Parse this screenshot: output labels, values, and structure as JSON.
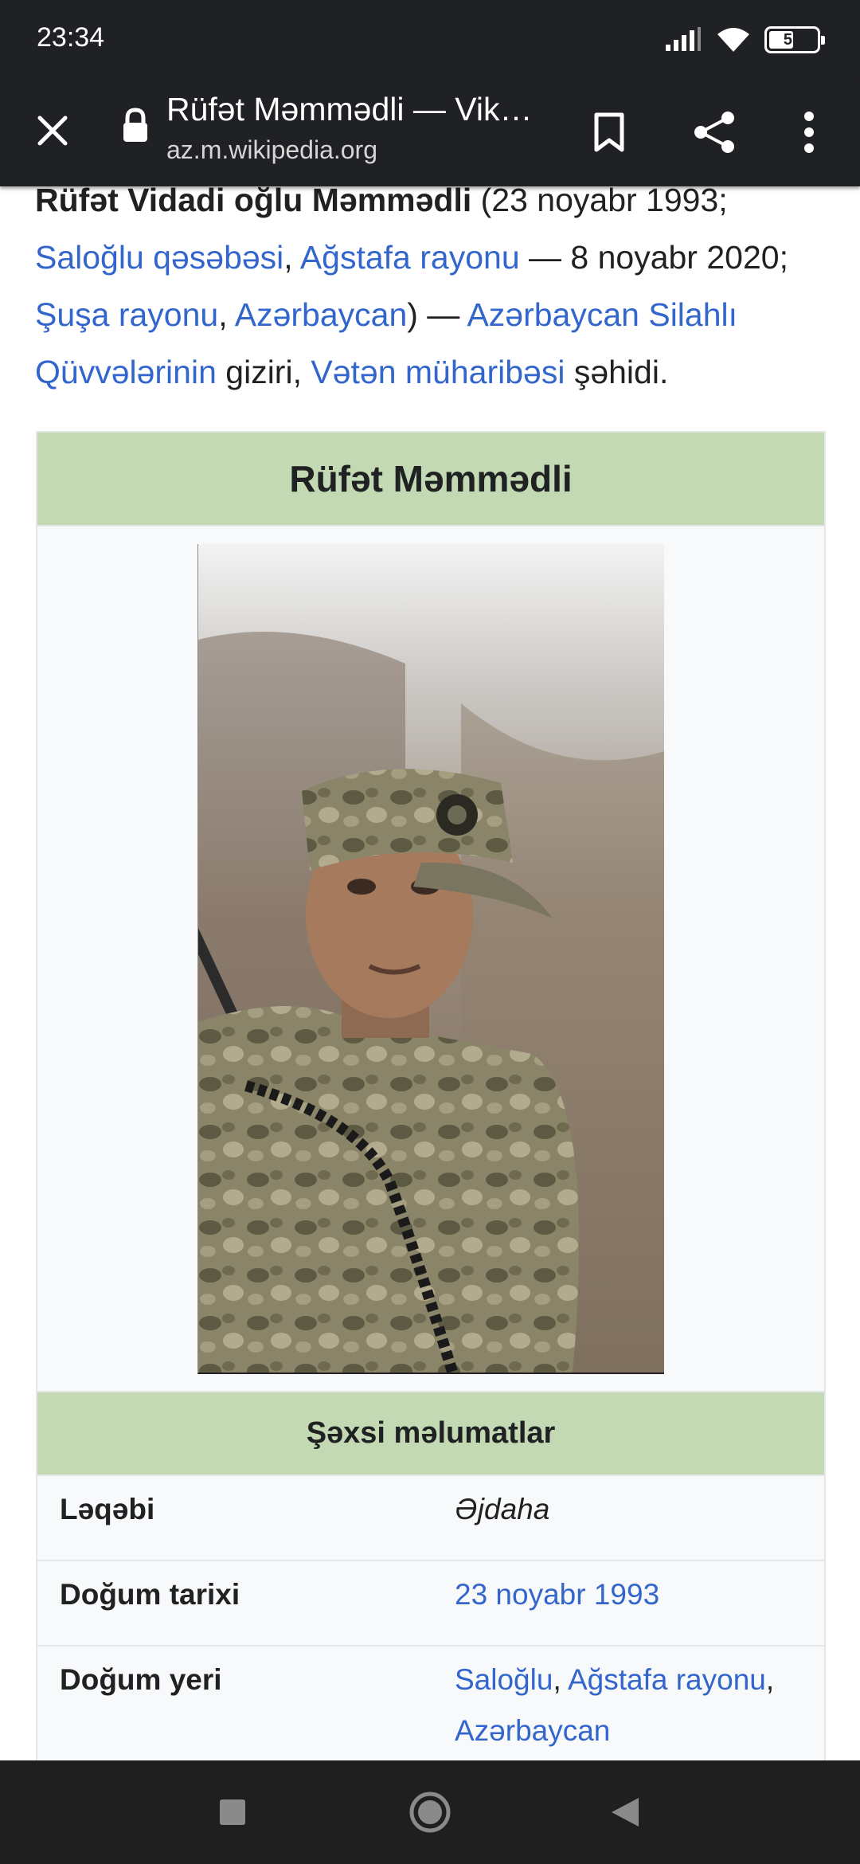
{
  "status_bar": {
    "time": "23:34",
    "battery": "55"
  },
  "browser": {
    "page_title": "Rüfət Məmmədli — Vik…",
    "url": "az.m.wikipedia.org",
    "icons": [
      "close-icon",
      "lock-icon",
      "bookmark-icon",
      "share-icon",
      "more-vert-icon"
    ]
  },
  "article": {
    "lead": {
      "line1_bold": "Rüfət Vidadi oğlu Məmmədli",
      "line1_rest": " (23 noyabr 1993;",
      "link_saloglu": "Saloğlu qəsəbəsi",
      "comma1": ", ",
      "link_agstafa": "Ağstafa rayonu",
      "text_death": " — 8 noyabr 2020;",
      "link_susa": "Şuşa rayonu",
      "comma2": ", ",
      "link_azerbaycan": "Azərbaycan",
      "text_dash": ") — ",
      "link_forces": "Azərbaycan Silahlı Qüvvələrinin",
      "text_giziri": " giziri, ",
      "link_war": "Vətən müharibəsi",
      "text_sehidi": " şəhidi."
    },
    "infobox": {
      "title": "Rüfət Məmmədli",
      "section_title": "Şəxsi məlumatlar",
      "rows": [
        {
          "label": "Ləqəbi",
          "value": "Əjdaha"
        },
        {
          "label": "Doğum tarixi",
          "value": "23 noyabr 1993"
        },
        {
          "label": "Doğum yeri",
          "value_link1": "Saloğlu",
          "value_sep": ", ",
          "value_link2": "Ağstafa rayonu",
          "value_sep2": ",",
          "value_link3": "Azərbaycan"
        }
      ]
    }
  },
  "nav_bar": {
    "icons": [
      "recents-square-icon",
      "home-circle-icon",
      "back-triangle-icon"
    ]
  }
}
